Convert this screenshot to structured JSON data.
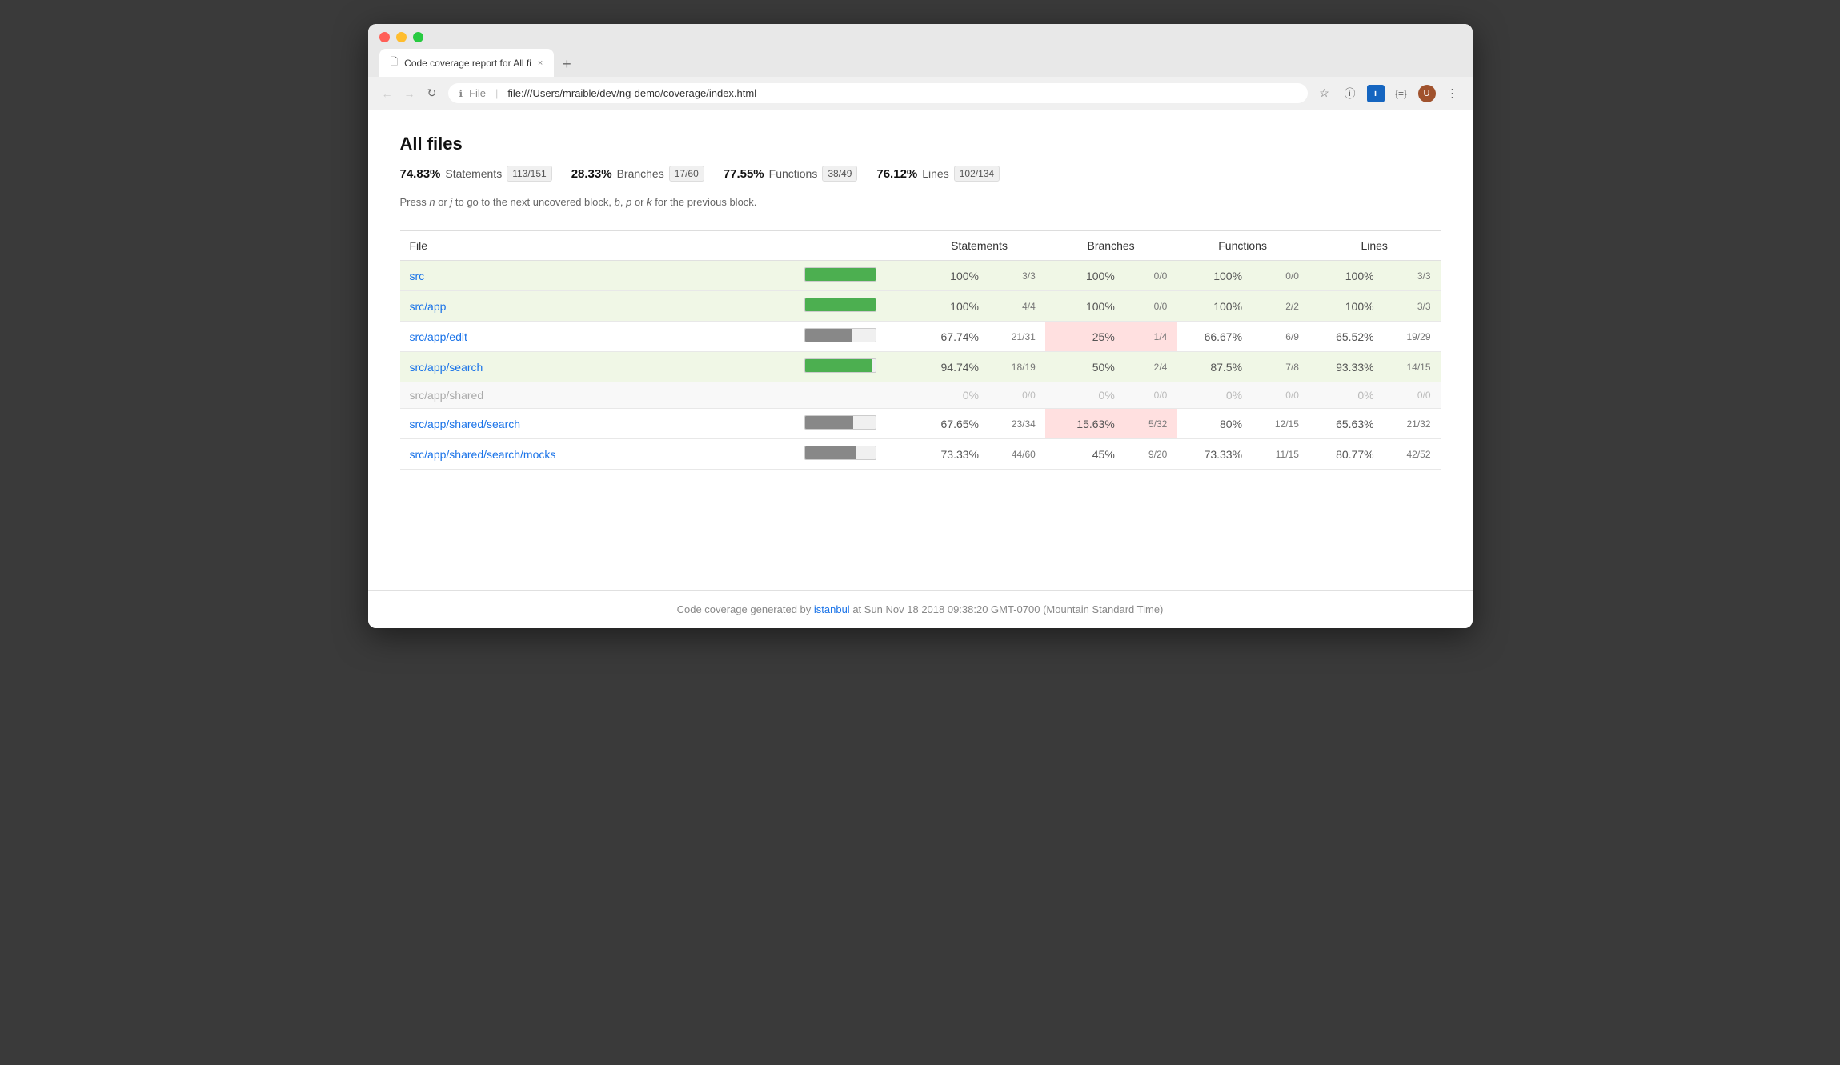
{
  "browser": {
    "tab_title": "Code coverage report for All fi",
    "tab_close": "×",
    "tab_new": "+",
    "url_protocol": "File",
    "url_path": "file:///Users/mraible/dev/ng-demo/coverage/index.html",
    "back_btn": "←",
    "forward_btn": "→",
    "refresh_btn": "↻",
    "menu_btn": "⋮"
  },
  "page": {
    "title": "All files",
    "keyboard_hint": "Press n or j to go to the next uncovered block, b, p or k for the previous block.",
    "metrics": [
      {
        "pct": "74.83%",
        "label": "Statements",
        "badge": "113/151"
      },
      {
        "pct": "28.33%",
        "label": "Branches",
        "badge": "17/60"
      },
      {
        "pct": "77.55%",
        "label": "Functions",
        "badge": "38/49"
      },
      {
        "pct": "76.12%",
        "label": "Lines",
        "badge": "102/134"
      }
    ],
    "table": {
      "headers": [
        "File",
        "Statements",
        "",
        "Branches",
        "",
        "Functions",
        "",
        "Lines",
        ""
      ],
      "col_headers": {
        "file": "File",
        "statements": "Statements",
        "branches": "Branches",
        "functions": "Functions",
        "lines": "Lines"
      },
      "rows": [
        {
          "file": "src",
          "link": true,
          "row_style": "green",
          "bar_pct": 100,
          "bar_type": "green",
          "stmt_pct": "100%",
          "stmt_frac": "3/3",
          "branch_pct": "100%",
          "branch_frac": "0/0",
          "func_pct": "100%",
          "func_frac": "0/0",
          "line_pct": "100%",
          "line_frac": "3/3"
        },
        {
          "file": "src/app",
          "link": true,
          "row_style": "green",
          "bar_pct": 100,
          "bar_type": "green",
          "stmt_pct": "100%",
          "stmt_frac": "4/4",
          "branch_pct": "100%",
          "branch_frac": "0/0",
          "func_pct": "100%",
          "func_frac": "2/2",
          "line_pct": "100%",
          "line_frac": "3/3"
        },
        {
          "file": "src/app/edit",
          "link": true,
          "row_style": "normal",
          "bar_pct": 67,
          "bar_type": "gray",
          "stmt_pct": "67.74%",
          "stmt_frac": "21/31",
          "branch_pct": "25%",
          "branch_frac": "1/4",
          "branch_style": "pink",
          "func_pct": "66.67%",
          "func_frac": "6/9",
          "line_pct": "65.52%",
          "line_frac": "19/29"
        },
        {
          "file": "src/app/search",
          "link": true,
          "row_style": "green",
          "bar_pct": 95,
          "bar_type": "green",
          "stmt_pct": "94.74%",
          "stmt_frac": "18/19",
          "branch_pct": "50%",
          "branch_frac": "2/4",
          "func_pct": "87.5%",
          "func_frac": "7/8",
          "line_pct": "93.33%",
          "line_frac": "14/15"
        },
        {
          "file": "src/app/shared",
          "link": false,
          "row_style": "gray",
          "bar_pct": 0,
          "bar_type": "empty",
          "stmt_pct": "0%",
          "stmt_frac": "0/0",
          "branch_pct": "0%",
          "branch_frac": "0/0",
          "func_pct": "0%",
          "func_frac": "0/0",
          "line_pct": "0%",
          "line_frac": "0/0"
        },
        {
          "file": "src/app/shared/search",
          "link": true,
          "row_style": "normal",
          "bar_pct": 68,
          "bar_type": "gray",
          "stmt_pct": "67.65%",
          "stmt_frac": "23/34",
          "branch_pct": "15.63%",
          "branch_frac": "5/32",
          "branch_style": "pink",
          "func_pct": "80%",
          "func_frac": "12/15",
          "line_pct": "65.63%",
          "line_frac": "21/32"
        },
        {
          "file": "src/app/shared/search/mocks",
          "link": true,
          "row_style": "normal",
          "bar_pct": 73,
          "bar_type": "gray",
          "stmt_pct": "73.33%",
          "stmt_frac": "44/60",
          "branch_pct": "45%",
          "branch_frac": "9/20",
          "func_pct": "73.33%",
          "func_frac": "11/15",
          "line_pct": "80.77%",
          "line_frac": "42/52"
        }
      ]
    },
    "footer": {
      "prefix": "Code coverage generated by ",
      "tool": "istanbul",
      "tool_link": "#",
      "suffix": " at Sun Nov 18 2018 09:38:20 GMT-0700 (Mountain Standard Time)"
    }
  }
}
